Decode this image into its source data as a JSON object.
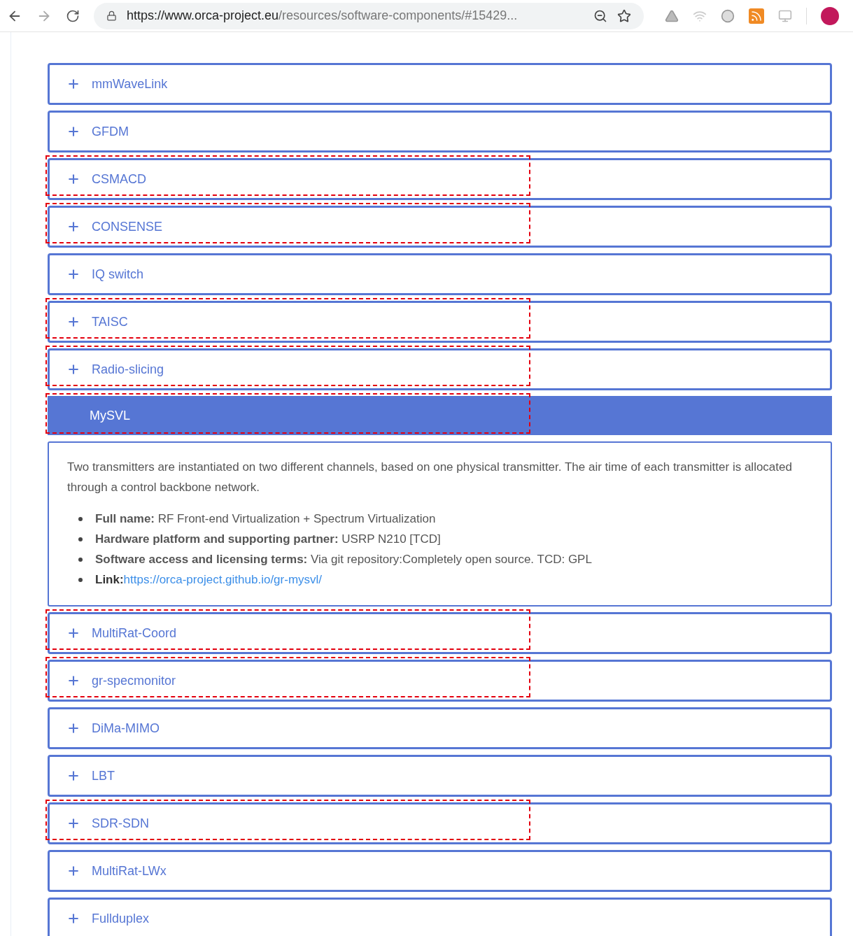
{
  "browser": {
    "url_host": "https://www.orca-project.eu",
    "url_path": "/resources/software-components/#15429..."
  },
  "accordion": [
    {
      "label": "mmWaveLink",
      "expanded": false,
      "highlighted": false
    },
    {
      "label": "GFDM",
      "expanded": false,
      "highlighted": false
    },
    {
      "label": "CSMACD",
      "expanded": false,
      "highlighted": true
    },
    {
      "label": "CONSENSE",
      "expanded": false,
      "highlighted": true
    },
    {
      "label": "IQ switch",
      "expanded": false,
      "highlighted": false
    },
    {
      "label": "TAISC",
      "expanded": false,
      "highlighted": true
    },
    {
      "label": "Radio-slicing",
      "expanded": false,
      "highlighted": true
    },
    {
      "label": "MySVL",
      "expanded": true,
      "highlighted": true,
      "body": {
        "description": "Two transmitters are instantiated on two different channels, based on one physical transmitter. The air time of each transmitter is allocated through a control backbone network.",
        "bullets": [
          {
            "kind": "text",
            "text": "**Full name:** RF Front-end Virtualization + Spectrum Virtualization"
          },
          {
            "kind": "text",
            "text": "**Hardware platform and supporting partner:** USRP N210 [TCD]"
          },
          {
            "kind": "text",
            "text": "**Software access and licensing terms:** Via git repository:Completely open source. TCD: GPL"
          },
          {
            "kind": "link",
            "label": "Link:",
            "url": "https://orca-project.github.io/gr-mysvl/"
          }
        ]
      }
    },
    {
      "label": "MultiRat-Coord",
      "expanded": false,
      "highlighted": true
    },
    {
      "label": "gr-specmonitor",
      "expanded": false,
      "highlighted": true
    },
    {
      "label": "DiMa-MIMO",
      "expanded": false,
      "highlighted": false
    },
    {
      "label": "LBT",
      "expanded": false,
      "highlighted": false
    },
    {
      "label": "SDR-SDN",
      "expanded": false,
      "highlighted": true
    },
    {
      "label": "MultiRat-LWx",
      "expanded": false,
      "highlighted": false
    },
    {
      "label": "Fullduplex",
      "expanded": false,
      "highlighted": false
    }
  ]
}
